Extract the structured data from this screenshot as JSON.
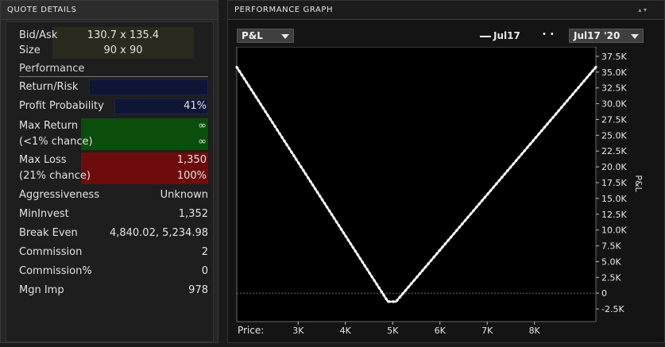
{
  "quote_details": {
    "title": "QUOTE DETAILS",
    "bid_ask_label": "Bid/Ask",
    "bid_ask_value": "130.7 x 135.4",
    "size_label": "Size",
    "size_value": "90 x 90",
    "performance_label": "Performance",
    "rows": [
      {
        "label": "Return/Risk",
        "value": ""
      },
      {
        "label": "Profit Probability",
        "value": "41%"
      },
      {
        "label": "Max Return",
        "value": "∞"
      },
      {
        "label": "(<1% chance)",
        "value": "∞"
      },
      {
        "label": "Max Loss",
        "value": "1,350"
      },
      {
        "label": "(21% chance)",
        "value": "100%"
      },
      {
        "label": "Aggressiveness",
        "value": "Unknown"
      },
      {
        "label": "MinInvest",
        "value": "1,352"
      },
      {
        "label": "Break Even",
        "value": "4,840.02, 5,234.98"
      },
      {
        "label": "Commission",
        "value": "2"
      },
      {
        "label": "Commission%",
        "value": "0"
      },
      {
        "label": "Mgn Imp",
        "value": "978"
      }
    ]
  },
  "performance_graph": {
    "title": "PERFORMANCE GRAPH",
    "metric_dropdown": "P&L",
    "legend_solid": "Jul17",
    "expiry_dropdown": "Jul17 '20",
    "y_axis_label": "P&L",
    "x_axis_prefix": "Price:"
  },
  "chart_data": {
    "type": "line",
    "ylabel": "P&L",
    "xlabel": "Price:",
    "x_ticks": [
      3000,
      4000,
      5000,
      6000,
      7000,
      8000
    ],
    "x_tick_labels": [
      "3K",
      "4K",
      "5K",
      "6K",
      "7K",
      "8K"
    ],
    "y_ticks": [
      37500,
      35000,
      32500,
      30000,
      27500,
      25000,
      22500,
      20000,
      17500,
      15000,
      12500,
      10000,
      7500,
      5000,
      2500,
      0,
      -2500
    ],
    "y_tick_labels": [
      "37.5K",
      "35.0K",
      "32.5K",
      "30.0K",
      "27.5K",
      "25.0K",
      "22.5K",
      "20.0K",
      "17.5K",
      "15.0K",
      "12.5K",
      "10.0K",
      "7.5K",
      "5.0K",
      "2.5K",
      "0",
      "-2.5K"
    ],
    "xlim": [
      1700,
      9300
    ],
    "ylim": [
      -4500,
      39000
    ],
    "series": [
      {
        "name": "Jul17",
        "x": [
          1700,
          4900,
          5070,
          9300
        ],
        "y": [
          35800,
          -1350,
          -1350,
          35800
        ]
      }
    ]
  }
}
